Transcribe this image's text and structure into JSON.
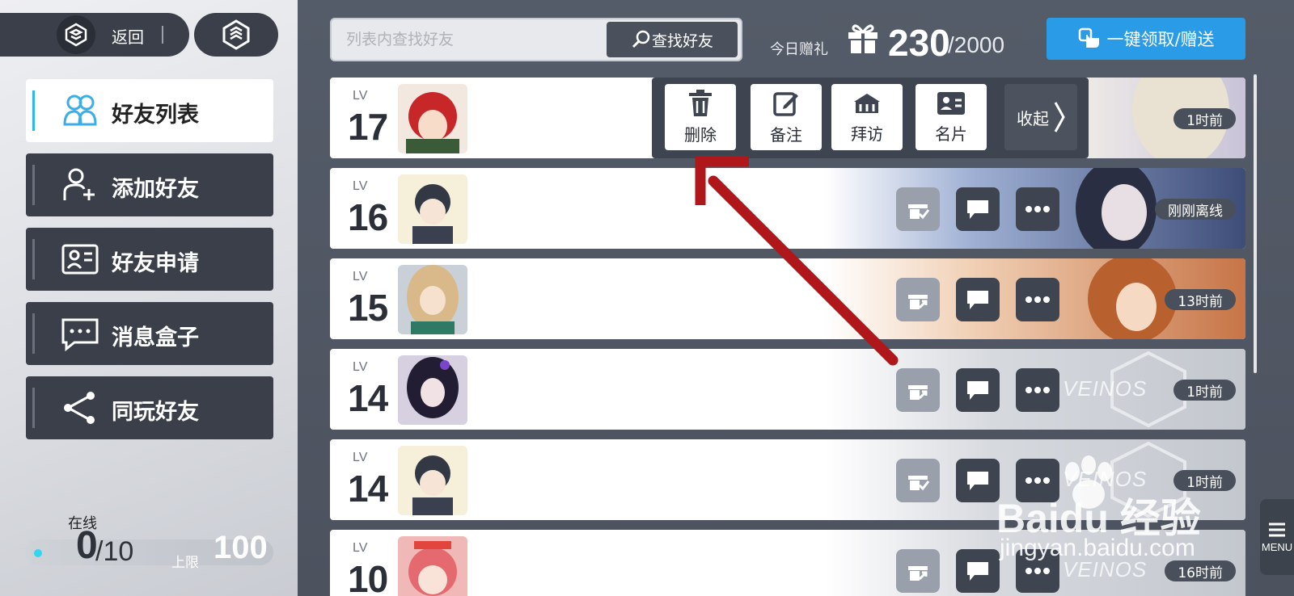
{
  "header": {
    "back_label": "返回",
    "search_placeholder": "列表内查找好友",
    "search_button": "查找好友",
    "gift_label": "今日赠礼",
    "gift_count": "230",
    "gift_max": "/2000",
    "claim_button": "一键领取/赠送"
  },
  "sidebar": {
    "items": [
      {
        "label": "好友列表",
        "icon": "friends-icon",
        "active": true
      },
      {
        "label": "添加好友",
        "icon": "add-user-icon",
        "active": false
      },
      {
        "label": "好友申请",
        "icon": "id-card-icon",
        "active": false
      },
      {
        "label": "消息盒子",
        "icon": "message-icon",
        "active": false
      },
      {
        "label": "同玩好友",
        "icon": "share-icon",
        "active": false
      }
    ],
    "online_label": "在线",
    "online_count": "0",
    "online_max": "/10",
    "limit_label": "上限",
    "limit_value": "100"
  },
  "friends": [
    {
      "lv_tag": "LV",
      "level": "17",
      "status": "1时前"
    },
    {
      "lv_tag": "LV",
      "level": "16",
      "status": "刚刚离线"
    },
    {
      "lv_tag": "LV",
      "level": "15",
      "status": "13时前"
    },
    {
      "lv_tag": "LV",
      "level": "14",
      "status": "1时前"
    },
    {
      "lv_tag": "LV",
      "level": "14",
      "status": "1时前"
    },
    {
      "lv_tag": "LV",
      "level": "10",
      "status": "16时前"
    }
  ],
  "popup": {
    "delete": "删除",
    "note": "备注",
    "visit": "拜访",
    "card": "名片",
    "collapse": "收起"
  },
  "row_brand": "VEINOS",
  "menu_label": "MENU",
  "watermark": {
    "main": "Baidu 经验",
    "url": "jingyan.baidu.com"
  },
  "colors": {
    "accent": "#2a9be6",
    "active_bar": "#2fb6ea",
    "arrow": "#b0171b"
  }
}
